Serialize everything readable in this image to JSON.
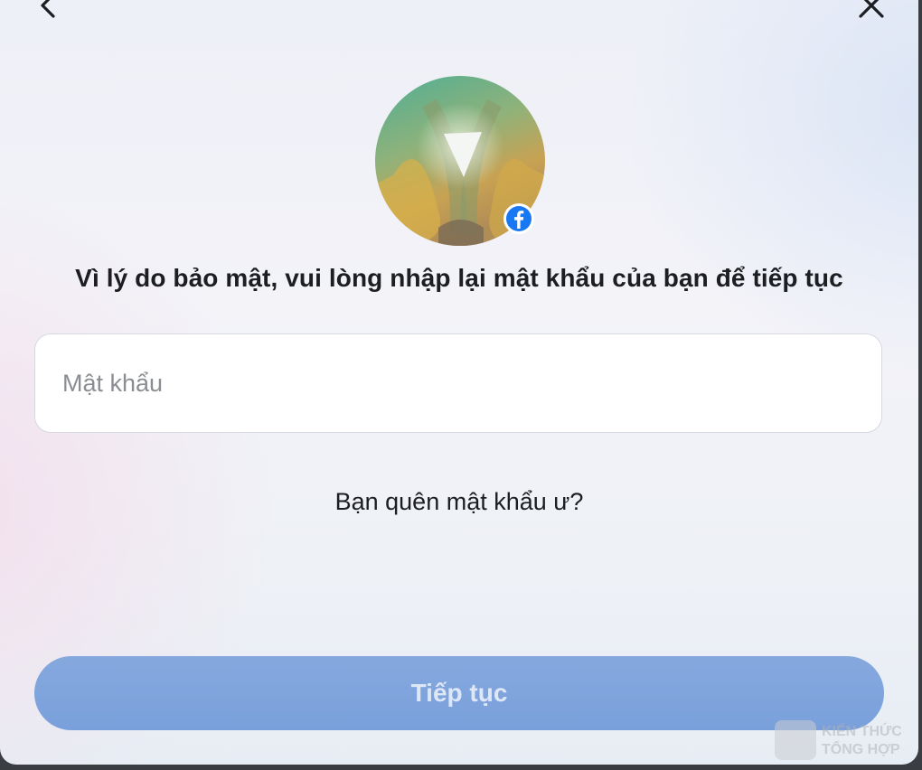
{
  "dialog": {
    "heading": "Vì lý do bảo mật, vui lòng nhập lại mật khẩu của bạn để tiếp tục",
    "password_placeholder": "Mật khẩu",
    "password_value": "",
    "forgot_link": "Bạn quên mật khẩu ư?",
    "continue_label": "Tiếp tục"
  },
  "icons": {
    "back": "chevron-left-icon",
    "close": "close-icon",
    "badge": "facebook-icon"
  },
  "watermark": {
    "line1": "KIẾN THỨC",
    "line2": "TỔNG HỢP"
  },
  "colors": {
    "button": "#7aa0db",
    "button_text": "#dde7f6",
    "facebook_blue": "#1877f2",
    "text": "#1c1e21"
  }
}
